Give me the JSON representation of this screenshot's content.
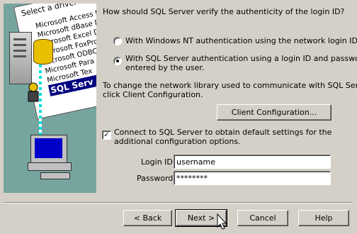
{
  "illustration": {
    "window_title": "Select a driver fo",
    "driver_items": [
      "Microsoft Access D",
      "Microsoft dBase Dr",
      "Microsoft Excel Dr",
      "Microsoft FoxPro",
      "Microsoft ODBC",
      "Microsoft Para",
      "Microsoft Tex"
    ],
    "selected_item": "SQL Serv"
  },
  "question": "How should SQL Server verify the authenticity of the login ID?",
  "auth_options": [
    {
      "line1": "With Windows NT authentication using the network login ID.",
      "line2": "",
      "selected": false
    },
    {
      "line1": "With SQL Server authentication using a login ID and password",
      "line2": "entered by the user.",
      "selected": true
    }
  ],
  "network_note": {
    "line1": "To change the network library used to communicate with SQL Server,",
    "line2": "click Client Configuration."
  },
  "client_config_button": "Client Configuration...",
  "connect_option": {
    "line1": "Connect to SQL Server to obtain default settings for the",
    "line2": "additional configuration options.",
    "checked": true,
    "check_glyph": "✓"
  },
  "login": {
    "label": "Login ID:",
    "value": "username"
  },
  "password": {
    "label": "Password:",
    "value": "********"
  },
  "buttons": {
    "back": "< Back",
    "next": "Next >",
    "cancel": "Cancel",
    "help": "Help"
  }
}
